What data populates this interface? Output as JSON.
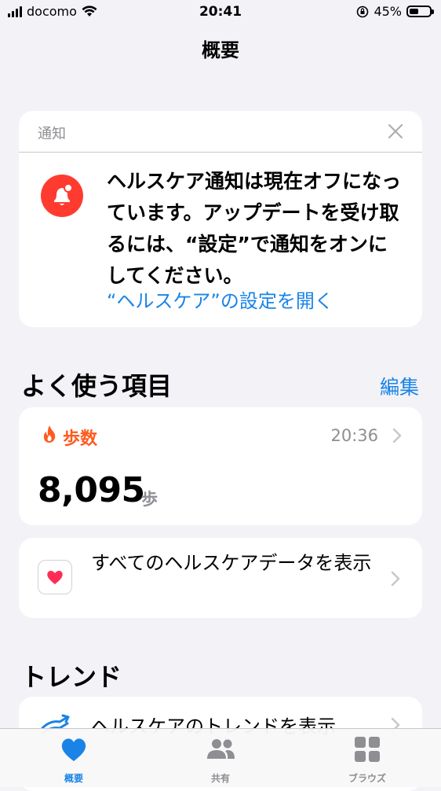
{
  "status_bar": {
    "carrier": "docomo",
    "time": "20:41",
    "battery": "45%",
    "battery_level": 0.45
  },
  "nav": {
    "title": "概要"
  },
  "notification": {
    "header": "通知",
    "message": "ヘルスケア通知は現在オフになっています。アップデートを受け取るには、“設定”で通知をオンにしてください。",
    "link": "“ヘルスケア”の設定を開く",
    "icon": "bell-icon"
  },
  "favorites": {
    "title": "よく使う項目",
    "edit": "編集"
  },
  "steps": {
    "label": "歩数",
    "time": "20:36",
    "value": "8,095",
    "unit": "歩"
  },
  "all_data": {
    "label": "すべてのヘルスケアデータを表示"
  },
  "trends": {
    "title": "トレンド",
    "label": "ヘルスケアのトレンドを表示"
  },
  "tabs": [
    {
      "label": "概要",
      "icon": "heart-icon",
      "active": true
    },
    {
      "label": "共有",
      "icon": "people-icon",
      "active": false
    },
    {
      "label": "ブラウズ",
      "icon": "grid-icon",
      "active": false
    }
  ],
  "colors": {
    "accent": "#1a84e6",
    "alert": "#ff3b30",
    "steps": "#ff5a1f",
    "active_tab": "#1a84e6",
    "inactive_tab": "#8e8e93"
  }
}
